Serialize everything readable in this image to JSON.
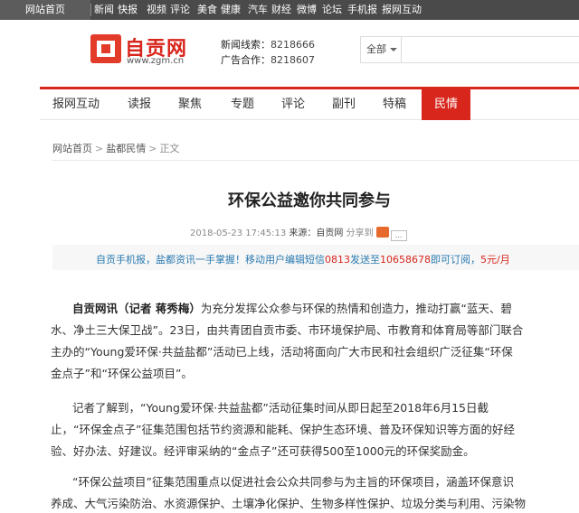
{
  "topbar": {
    "home": "网站首页",
    "links": [
      "新闻",
      "快报",
      "视频",
      "评论",
      "美食",
      "健康",
      "汽车",
      "财经",
      "微博",
      "论坛",
      "手机报",
      "报网互动"
    ]
  },
  "brand": {
    "logo_text": "自贡网",
    "logo_url": "www.zgm.cn"
  },
  "contact": {
    "news_label": "新闻线索：",
    "news_number": "8218666",
    "ad_label": "广告合作：",
    "ad_number": "8218607"
  },
  "search": {
    "scope": "全部",
    "placeholder": ""
  },
  "nav": {
    "items": [
      "报网互动",
      "读报",
      "聚焦",
      "专题",
      "评论",
      "副刊",
      "特稿",
      "民情"
    ],
    "active": "民情"
  },
  "breadcrumb": {
    "home": "网站首页",
    "section": "盐都民情",
    "current": "正文",
    "separator": ">"
  },
  "article": {
    "title": "环保公益邀你共同参与",
    "datetime": "2018-05-23 17:45:13",
    "source": "来源：自贡网",
    "share": "分享到",
    "more": "..."
  },
  "notice": {
    "part1": "自贡手机报，盐都资讯一手掌握！移动用户编辑短信",
    "code": "0813",
    "part2": "发送至",
    "number": "10658678",
    "part3": "即可订阅，",
    "price": "5元/月"
  },
  "body": {
    "p1": {
      "lead": "自贡网讯（记者 蒋秀梅）",
      "line1": "为充分发挥公众参与环保的热情和创造力，推动打赢“蓝天、碧",
      "line2": "水、净土三大保卫战”。23日，由共青团自贡市委、市环境保护局、市教育和体育局等部门联合",
      "line3": "主办的“Young爱环保·共益盐都”活动已上线，活动将面向广大市民和社会组织广泛征集“环保",
      "line4": "金点子”和“环保公益项目”。"
    },
    "p2": {
      "line1": "记者了解到，“Young爱环保·共益盐都”活动征集时间从即日起至2018年6月15日截",
      "line2": "止，“环保金点子”征集范围包括节约资源和能耗、保护生态环境、普及环保知识等方面的好经",
      "line3": "验、好办法、好建议。经评审采纳的“金点子”还可获得500至1000元的环保奖励金。"
    },
    "p3": {
      "line1": "“环保公益项目”征集范围重点以促进社会公众共同参与为主旨的环保项目，涵盖环保意识",
      "line2": "养成、大气污染防治、水资源保护、土壤净化保护、生物多样性保护、垃圾分类与利用、污染物"
    }
  },
  "colors": {
    "brand_red": "#d8261d",
    "topbar_bg": "#4a4a4a",
    "link_blue": "#2a7ab0",
    "share_icon": "#e56a2c"
  },
  "icons": {
    "logo": "zgm-logo-icon",
    "caret": "caret-down-icon",
    "share": "share-weibo-icon",
    "more": "more-icon"
  }
}
